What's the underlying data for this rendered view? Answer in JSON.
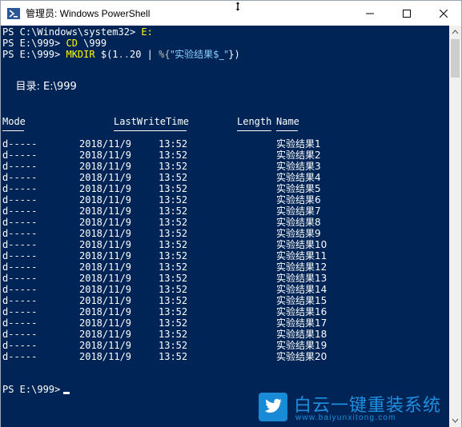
{
  "window": {
    "title": "管理员: Windows PowerShell",
    "minimize_glyph": "—",
    "maximize_glyph": "☐",
    "close_glyph": "✕"
  },
  "console": {
    "lines": [
      {
        "prompt": "PS C:\\Windows\\system32> ",
        "cmd": "E:"
      },
      {
        "prompt": "PS E:\\999> ",
        "cmd": "CD ",
        "arg": "\\999"
      },
      {
        "prompt": "PS E:\\999> ",
        "cmd": "MKDIR ",
        "rest1": "$(1",
        "op": "..",
        "rest2": "20 | ",
        "rest3": "%{",
        "str": "\"实验结果$_\"",
        "rest4": "})"
      }
    ],
    "directory_label": "    目录: E:\\999",
    "headers": {
      "mode": "Mode",
      "lastwritetime": "LastWriteTime",
      "length": "Length",
      "name": "Name"
    },
    "rows": [
      {
        "mode": "d-----",
        "date": "2018/11/9",
        "time": "13:52",
        "name": "实验结果1"
      },
      {
        "mode": "d-----",
        "date": "2018/11/9",
        "time": "13:52",
        "name": "实验结果2"
      },
      {
        "mode": "d-----",
        "date": "2018/11/9",
        "time": "13:52",
        "name": "实验结果3"
      },
      {
        "mode": "d-----",
        "date": "2018/11/9",
        "time": "13:52",
        "name": "实验结果4"
      },
      {
        "mode": "d-----",
        "date": "2018/11/9",
        "time": "13:52",
        "name": "实验结果5"
      },
      {
        "mode": "d-----",
        "date": "2018/11/9",
        "time": "13:52",
        "name": "实验结果6"
      },
      {
        "mode": "d-----",
        "date": "2018/11/9",
        "time": "13:52",
        "name": "实验结果7"
      },
      {
        "mode": "d-----",
        "date": "2018/11/9",
        "time": "13:52",
        "name": "实验结果8"
      },
      {
        "mode": "d-----",
        "date": "2018/11/9",
        "time": "13:52",
        "name": "实验结果9"
      },
      {
        "mode": "d-----",
        "date": "2018/11/9",
        "time": "13:52",
        "name": "实验结果10"
      },
      {
        "mode": "d-----",
        "date": "2018/11/9",
        "time": "13:52",
        "name": "实验结果11"
      },
      {
        "mode": "d-----",
        "date": "2018/11/9",
        "time": "13:52",
        "name": "实验结果12"
      },
      {
        "mode": "d-----",
        "date": "2018/11/9",
        "time": "13:52",
        "name": "实验结果13"
      },
      {
        "mode": "d-----",
        "date": "2018/11/9",
        "time": "13:52",
        "name": "实验结果14"
      },
      {
        "mode": "d-----",
        "date": "2018/11/9",
        "time": "13:52",
        "name": "实验结果15"
      },
      {
        "mode": "d-----",
        "date": "2018/11/9",
        "time": "13:52",
        "name": "实验结果16"
      },
      {
        "mode": "d-----",
        "date": "2018/11/9",
        "time": "13:52",
        "name": "实验结果17"
      },
      {
        "mode": "d-----",
        "date": "2018/11/9",
        "time": "13:52",
        "name": "实验结果18"
      },
      {
        "mode": "d-----",
        "date": "2018/11/9",
        "time": "13:52",
        "name": "实验结果19"
      },
      {
        "mode": "d-----",
        "date": "2018/11/9",
        "time": "13:52",
        "name": "实验结果20"
      }
    ],
    "final_prompt": "PS E:\\999> "
  },
  "watermark": {
    "title": "白云一键重装系统",
    "url": "www.baiyunxitong.com",
    "icon": "twitter-bird-icon"
  },
  "colors": {
    "console_bg": "#012456",
    "prompt_text": "#ffffff",
    "command_yellow": "#ffff00",
    "string_cyan": "#87cefa",
    "brand_blue": "#1f8fe0"
  }
}
